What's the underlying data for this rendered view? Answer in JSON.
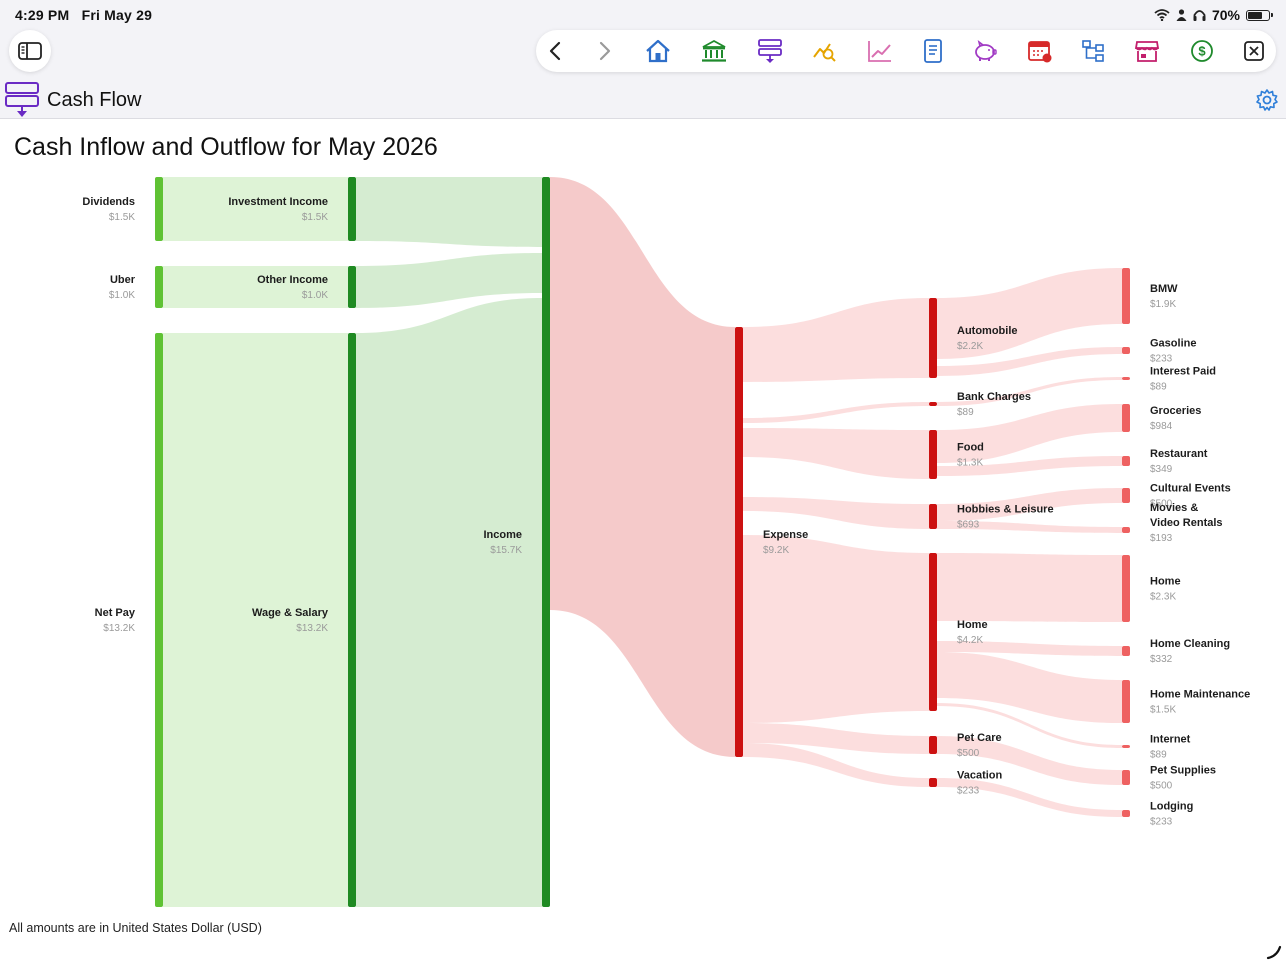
{
  "status_bar": {
    "time": "4:29 PM",
    "date": "Fri May 29",
    "battery": "70%"
  },
  "toolbar": {
    "buttons": [
      {
        "icon": "chevron-left-icon",
        "color": "#222222"
      },
      {
        "icon": "chevron-right-icon",
        "color": "#9a9a9a"
      },
      {
        "icon": "home-icon",
        "color": "#2f6fc9"
      },
      {
        "icon": "bank-icon",
        "color": "#1f8a2c"
      },
      {
        "icon": "cash-flow-icon",
        "color": "#6a2bc4"
      },
      {
        "icon": "investment-search-icon",
        "color": "#e5a400"
      },
      {
        "icon": "trend-chart-icon",
        "color": "#d96fb0"
      },
      {
        "icon": "report-icon",
        "color": "#2f6fc9"
      },
      {
        "icon": "piggy-bank-icon",
        "color": "#a13bc4"
      },
      {
        "icon": "calendar-icon",
        "color": "#d62a2a"
      },
      {
        "icon": "hierarchy-icon",
        "color": "#2f6fc9"
      },
      {
        "icon": "store-icon",
        "color": "#c21f6c"
      },
      {
        "icon": "dollar-circle-icon",
        "color": "#1f8a2c"
      },
      {
        "icon": "close-icon",
        "color": "#222222"
      }
    ]
  },
  "page": {
    "title": "Cash Flow"
  },
  "report": {
    "title": "Cash Inflow and Outflow for May 2026",
    "footnote": "All amounts are in United States Dollar (USD)"
  },
  "chart_data": {
    "type": "sankey",
    "colors": {
      "income_node_light": "#5fc234",
      "income_node_dark": "#1f8a22",
      "expense_node": "#cc1111",
      "leaf_node": "#ee6161"
    },
    "nodes": [
      {
        "id": "dividends",
        "label": "Dividends",
        "value": "$1.5K"
      },
      {
        "id": "uber",
        "label": "Uber",
        "value": "$1.0K"
      },
      {
        "id": "net-pay",
        "label": "Net Pay",
        "value": "$13.2K"
      },
      {
        "id": "investment-income",
        "label": "Investment Income",
        "value": "$1.5K"
      },
      {
        "id": "other-income",
        "label": "Other Income",
        "value": "$1.0K"
      },
      {
        "id": "wage-salary",
        "label": "Wage & Salary",
        "value": "$13.2K"
      },
      {
        "id": "income",
        "label": "Income",
        "value": "$15.7K"
      },
      {
        "id": "expense",
        "label": "Expense",
        "value": "$9.2K"
      },
      {
        "id": "automobile",
        "label": "Automobile",
        "value": "$2.2K"
      },
      {
        "id": "bank-charges",
        "label": "Bank Charges",
        "value": "$89"
      },
      {
        "id": "food",
        "label": "Food",
        "value": "$1.3K"
      },
      {
        "id": "hobbies-leisure",
        "label": "Hobbies & Leisure",
        "value": "$693"
      },
      {
        "id": "home",
        "label": "Home",
        "value": "$4.2K"
      },
      {
        "id": "pet-care",
        "label": "Pet Care",
        "value": "$500"
      },
      {
        "id": "vacation",
        "label": "Vacation",
        "value": "$233"
      },
      {
        "id": "bmw",
        "label": "BMW",
        "value": "$1.9K"
      },
      {
        "id": "gasoline",
        "label": "Gasoline",
        "value": "$233"
      },
      {
        "id": "interest-paid",
        "label": "Interest Paid",
        "value": "$89"
      },
      {
        "id": "groceries",
        "label": "Groceries",
        "value": "$984"
      },
      {
        "id": "restaurant",
        "label": "Restaurant",
        "value": "$349"
      },
      {
        "id": "cultural-events",
        "label": "Cultural Events",
        "value": "$500"
      },
      {
        "id": "movies-video-rentals",
        "label": "Movies &\nVideo Rentals",
        "value": "$193"
      },
      {
        "id": "home-leaf",
        "label": "Home",
        "value": "$2.3K"
      },
      {
        "id": "home-cleaning",
        "label": "Home Cleaning",
        "value": "$332"
      },
      {
        "id": "home-maintenance",
        "label": "Home Maintenance",
        "value": "$1.5K"
      },
      {
        "id": "internet",
        "label": "Internet",
        "value": "$89"
      },
      {
        "id": "pet-supplies",
        "label": "Pet Supplies",
        "value": "$500"
      },
      {
        "id": "lodging",
        "label": "Lodging",
        "value": "$233"
      }
    ],
    "links": [
      {
        "source": "dividends",
        "target": "investment-income",
        "value": 1500
      },
      {
        "source": "uber",
        "target": "other-income",
        "value": 1000
      },
      {
        "source": "net-pay",
        "target": "wage-salary",
        "value": 13200
      },
      {
        "source": "investment-income",
        "target": "income",
        "value": 1500
      },
      {
        "source": "other-income",
        "target": "income",
        "value": 1000
      },
      {
        "source": "wage-salary",
        "target": "income",
        "value": 13200
      },
      {
        "source": "income",
        "target": "expense",
        "value": 9200
      },
      {
        "source": "expense",
        "target": "automobile",
        "value": 2200
      },
      {
        "source": "expense",
        "target": "bank-charges",
        "value": 89
      },
      {
        "source": "expense",
        "target": "food",
        "value": 1300
      },
      {
        "source": "expense",
        "target": "hobbies-leisure",
        "value": 693
      },
      {
        "source": "expense",
        "target": "home",
        "value": 4200
      },
      {
        "source": "expense",
        "target": "pet-care",
        "value": 500
      },
      {
        "source": "expense",
        "target": "vacation",
        "value": 233
      },
      {
        "source": "automobile",
        "target": "bmw",
        "value": 1900
      },
      {
        "source": "automobile",
        "target": "gasoline",
        "value": 233
      },
      {
        "source": "bank-charges",
        "target": "interest-paid",
        "value": 89
      },
      {
        "source": "food",
        "target": "groceries",
        "value": 984
      },
      {
        "source": "food",
        "target": "restaurant",
        "value": 349
      },
      {
        "source": "hobbies-leisure",
        "target": "cultural-events",
        "value": 500
      },
      {
        "source": "hobbies-leisure",
        "target": "movies-video-rentals",
        "value": 193
      },
      {
        "source": "home",
        "target": "home-leaf",
        "value": 2300
      },
      {
        "source": "home",
        "target": "home-cleaning",
        "value": 332
      },
      {
        "source": "home",
        "target": "home-maintenance",
        "value": 1500
      },
      {
        "source": "home",
        "target": "internet",
        "value": 89
      },
      {
        "source": "pet-care",
        "target": "pet-supplies",
        "value": 500
      },
      {
        "source": "vacation",
        "target": "lodging",
        "value": 233
      }
    ]
  }
}
